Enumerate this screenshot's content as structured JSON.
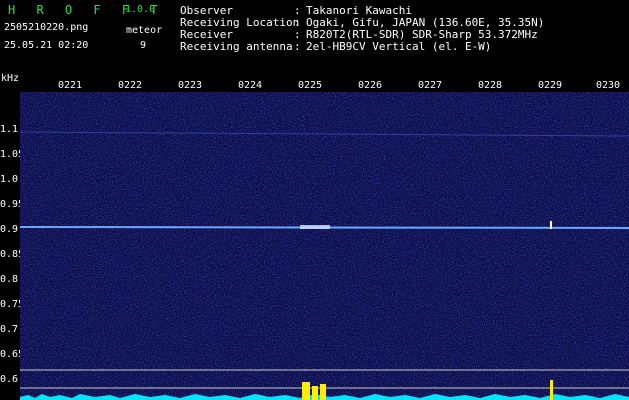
{
  "header": {
    "app_title": "H R O F F T",
    "app_version": "1.0.0",
    "file_name": "2505210220.png",
    "date_time": "25.05.21 02:20",
    "meteor_label": "meteor",
    "meteor_count": "9"
  },
  "info": [
    {
      "label": "Observer",
      "value": "Takanori Kawachi"
    },
    {
      "label": "Receiving Location",
      "value": "Ogaki, Gifu, JAPAN (136.60E, 35.35N)"
    },
    {
      "label": "Receiver",
      "value": "R820T2(RTL-SDR) SDR-Sharp 53.372MHz"
    },
    {
      "label": "Receiving antenna",
      "value": "2el-HB9CV Vertical (el. E-W)"
    }
  ],
  "axis": {
    "unit_label": "kHz",
    "time_ticks": [
      "0221",
      "0222",
      "0223",
      "0224",
      "0225",
      "0226",
      "0227",
      "0228",
      "0229",
      "0230"
    ],
    "freq_ticks": [
      "1.1",
      "1.05",
      "1.0",
      "0.95",
      "0.9",
      "0.85",
      "0.8",
      "0.75",
      "0.7",
      "0.65",
      "0.6"
    ]
  },
  "colors": {
    "background": "#000000",
    "header_accent": "#27e03a",
    "spectrogram_bg": "#0b0c4a",
    "carrier_line": "#6aa7ff",
    "meteor_echo": "#ffee00",
    "noise_floor": "#00e5ff"
  }
}
